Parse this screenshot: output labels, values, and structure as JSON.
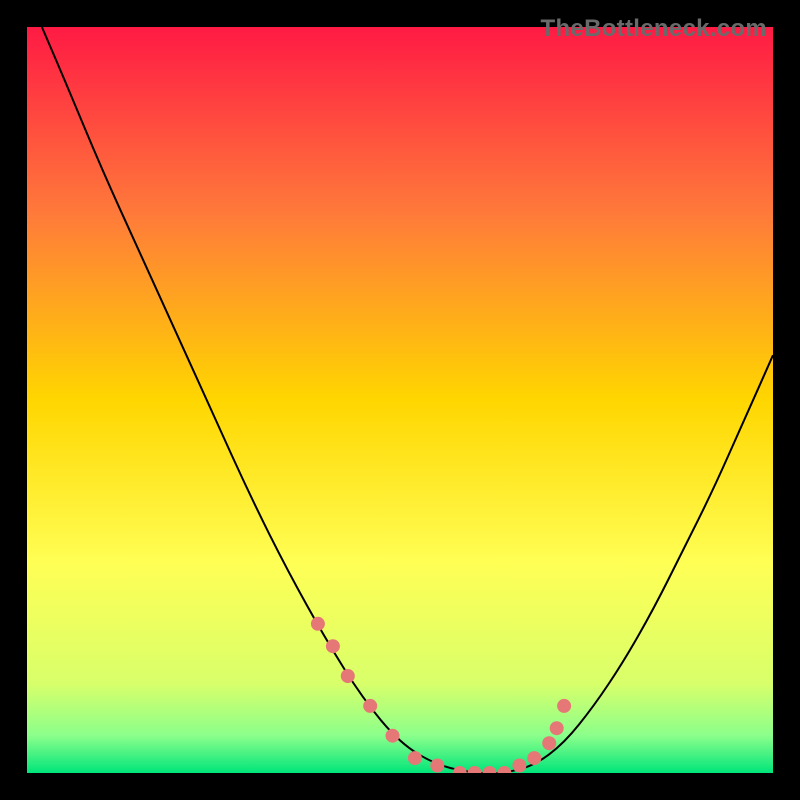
{
  "watermark": "TheBottleneck.com",
  "colors": {
    "gradient_top": "#ff1a44",
    "gradient_mid1": "#ff7a3a",
    "gradient_mid2": "#ffd600",
    "gradient_mid3": "#ffff55",
    "gradient_mid4": "#d8ff6a",
    "gradient_mid5": "#8bff8b",
    "gradient_bottom": "#00e57a",
    "curve": "#000000",
    "dot": "#e67777",
    "background": "#000000"
  },
  "chart_data": {
    "type": "line",
    "title": "",
    "xlabel": "",
    "ylabel": "",
    "xlim": [
      0,
      100
    ],
    "ylim": [
      0,
      100
    ],
    "grid": false,
    "series": [
      {
        "name": "bottleneck-curve",
        "x": [
          2,
          5,
          10,
          15,
          20,
          25,
          30,
          35,
          40,
          45,
          50,
          55,
          60,
          62,
          64,
          68,
          72,
          76,
          80,
          84,
          88,
          92,
          96,
          100
        ],
        "y": [
          100,
          93,
          81,
          70,
          59,
          48,
          37,
          27,
          18,
          10,
          4,
          1,
          0,
          0,
          0,
          1,
          4,
          9,
          15,
          22,
          30,
          38,
          47,
          56
        ]
      }
    ],
    "markers": {
      "name": "highlight-dots",
      "x": [
        39,
        41,
        43,
        46,
        49,
        52,
        55,
        58,
        60,
        62,
        64,
        66,
        68,
        70,
        71,
        72
      ],
      "y": [
        20,
        17,
        13,
        9,
        5,
        2,
        1,
        0,
        0,
        0,
        0,
        1,
        2,
        4,
        6,
        9
      ]
    }
  }
}
